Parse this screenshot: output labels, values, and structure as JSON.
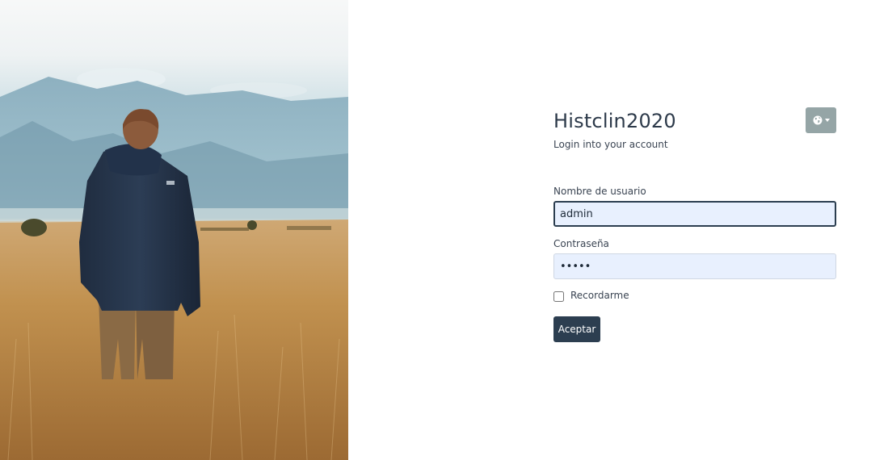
{
  "app": {
    "title": "Histclin2020",
    "subtitle": "Login into your account"
  },
  "language_menu": {
    "icon": "globe-icon",
    "dropdown_icon": "caret-down-icon"
  },
  "form": {
    "username_label": "Nombre de usuario",
    "username_value": "admin",
    "password_label": "Contraseña",
    "password_value": "admin",
    "remember_label": "Recordarme",
    "remember_checked": false,
    "submit_label": "Aceptar"
  },
  "colors": {
    "primary": "#2c3e50",
    "language_button": "#95a5a6",
    "autofill_bg": "#e8f0fe"
  }
}
